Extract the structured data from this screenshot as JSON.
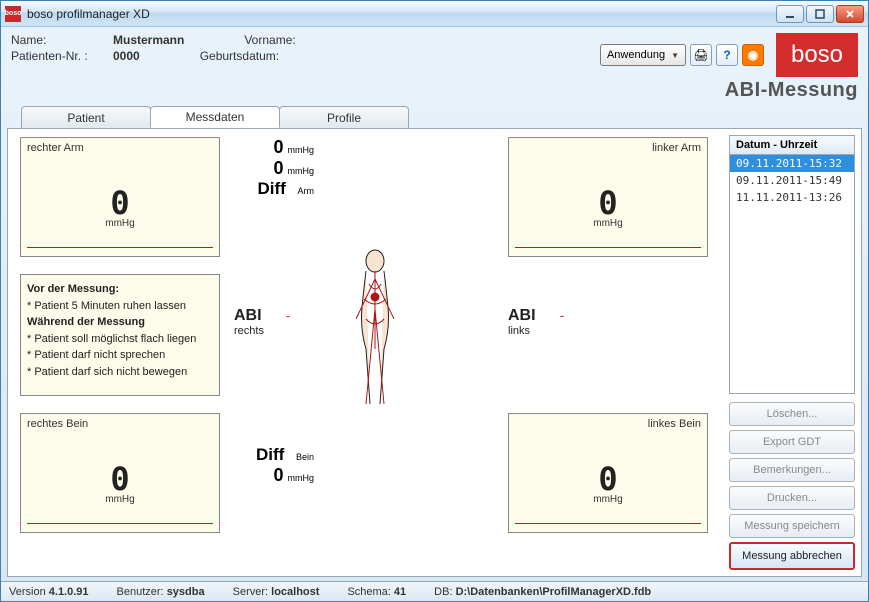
{
  "window": {
    "title": "boso profilmanager XD",
    "app_icon_text": "boso"
  },
  "header": {
    "name_label": "Name:",
    "name_value": "Mustermann",
    "vorname_label": "Vorname:",
    "vorname_value": "",
    "patnr_label": "Patienten-Nr. :",
    "patnr_value": "0000",
    "geb_label": "Geburtsdatum:",
    "geb_value": "",
    "app_combo": "Anwendung",
    "subtitle": "ABI-Messung",
    "brand": "boso"
  },
  "tabs": {
    "patient": "Patient",
    "messdaten": "Messdaten",
    "profile": "Profile",
    "active": "messdaten"
  },
  "cards": {
    "ra": {
      "title": "rechter Arm",
      "value": "0",
      "unit": "mmHg"
    },
    "la": {
      "title": "linker Arm",
      "value": "0",
      "unit": "mmHg"
    },
    "rb": {
      "title": "rechtes Bein",
      "value": "0",
      "unit": "mmHg"
    },
    "lb": {
      "title": "linkes Bein",
      "value": "0",
      "unit": "mmHg"
    }
  },
  "diff": {
    "top1_val": "0",
    "top1_unit": "mmHg",
    "top2_val": "0",
    "top2_unit": "mmHg",
    "diff_label": "Diff",
    "arm_label": "Arm",
    "bein_label": "Bein",
    "bot_val": "0",
    "bot_unit": "mmHg"
  },
  "abi": {
    "label": "ABI",
    "rechts": "rechts",
    "links": "links",
    "dash": "-"
  },
  "info": {
    "h1": "Vor der Messung:",
    "l1": "* Patient 5 Minuten ruhen lassen",
    "h2": "Während der Messung",
    "l2": "* Patient soll möglichst flach liegen",
    "l3": "* Patient darf nicht sprechen",
    "l4": "* Patient darf sich nicht bewegen"
  },
  "sidelist": {
    "header": "Datum - Uhrzeit",
    "items": [
      "09.11.2011-15:32",
      "09.11.2011-15:49",
      "11.11.2011-13:26"
    ],
    "selected": 0
  },
  "buttons": {
    "loeschen": "Löschen...",
    "export": "Export GDT",
    "bemerk": "Bemerkungen...",
    "drucken": "Drucken...",
    "speichern": "Messung speichern",
    "abbrechen": "Messung abbrechen"
  },
  "status": {
    "version_label": "Version",
    "version": "4.1.0.91",
    "user_label": "Benutzer:",
    "user": "sysdba",
    "server_label": "Server:",
    "server": "localhost",
    "schema_label": "Schema:",
    "schema": "41",
    "db_label": "DB:",
    "db": "D:\\Datenbanken\\ProfilManagerXD.fdb"
  }
}
